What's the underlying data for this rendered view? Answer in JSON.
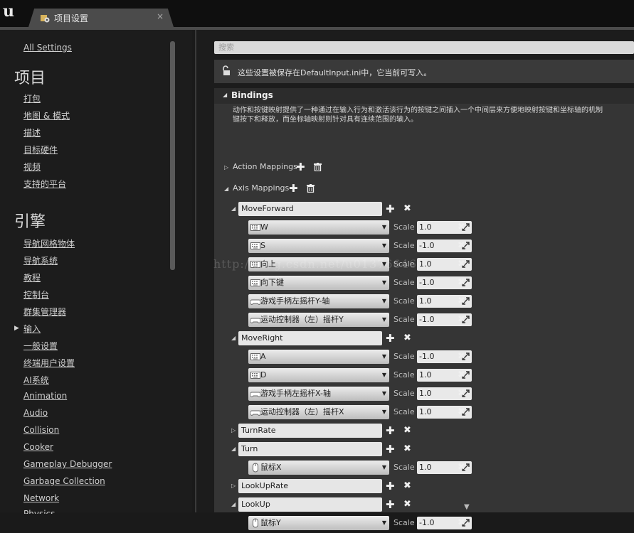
{
  "tab": {
    "title": "项目设置",
    "close": "×"
  },
  "sidebar": {
    "all_settings": "All Settings",
    "section1": "项目",
    "items1": [
      "打包",
      "地图 & 模式",
      "描述",
      "目标硬件",
      "视频",
      "支持的平台"
    ],
    "section2": "引擎",
    "items2": [
      "导航网格物体",
      "导航系统",
      "教程",
      "控制台",
      "群集管理器",
      "输入",
      "一般设置",
      "终端用户设置",
      "AI系统",
      "Animation",
      "Audio",
      "Collision",
      "Cooker",
      "Gameplay Debugger",
      "Garbage Collection",
      "Network",
      "Physics"
    ],
    "selected": "输入"
  },
  "search": {
    "placeholder": "搜索"
  },
  "notice": {
    "text": "这些设置被保存在DefaultInput.ini中，它当前可写入。"
  },
  "bindings": {
    "title": "Bindings",
    "description_line1": "动作和按键映射提供了一种通过在输入行为和激活该行为的按键之间插入一个中间层来方便地映射按键和坐标轴的机制",
    "description_line2": "键按下和释放，而坐标轴映射则针对具有连续范围的输入。",
    "action_mappings": "Action Mappings",
    "axis_mappings": "Axis Mappings",
    "scale_label": "Scale",
    "groups": [
      {
        "name": "MoveForward",
        "expanded": true,
        "keys": [
          {
            "key": "W",
            "icon": "keyboard-icon",
            "scale": "1.0"
          },
          {
            "key": "S",
            "icon": "keyboard-icon",
            "scale": "-1.0"
          },
          {
            "key": "向上",
            "icon": "keyboard-icon",
            "scale": "1.0"
          },
          {
            "key": "向下键",
            "icon": "keyboard-icon",
            "scale": "-1.0"
          },
          {
            "key": "游戏手柄左摇杆Y-轴",
            "icon": "gamepad-icon",
            "scale": "1.0"
          },
          {
            "key": "运动控制器（左）摇杆Y",
            "icon": "gamepad-icon",
            "scale": "-1.0"
          }
        ]
      },
      {
        "name": "MoveRight",
        "expanded": true,
        "keys": [
          {
            "key": "A",
            "icon": "keyboard-icon",
            "scale": "-1.0"
          },
          {
            "key": "D",
            "icon": "keyboard-icon",
            "scale": "1.0"
          },
          {
            "key": "游戏手柄左摇杆X-轴",
            "icon": "gamepad-icon",
            "scale": "1.0"
          },
          {
            "key": "运动控制器（左）摇杆X",
            "icon": "gamepad-icon",
            "scale": "1.0"
          }
        ]
      },
      {
        "name": "TurnRate",
        "expanded": false,
        "keys": []
      },
      {
        "name": "Turn",
        "expanded": true,
        "keys": [
          {
            "key": "鼠标X",
            "icon": "mouse-icon",
            "scale": "1.0"
          }
        ]
      },
      {
        "name": "LookUpRate",
        "expanded": false,
        "keys": []
      },
      {
        "name": "LookUp",
        "expanded": true,
        "keys": [
          {
            "key": "鼠标Y",
            "icon": "mouse-icon",
            "scale": "-1.0"
          }
        ]
      }
    ]
  },
  "watermark": "http://blog.csdn.net/u013766466",
  "colors": {
    "background": "#1c1c1c",
    "panel": "#353535",
    "field": "#e6e6e6",
    "tab": "#4b4b4b"
  }
}
